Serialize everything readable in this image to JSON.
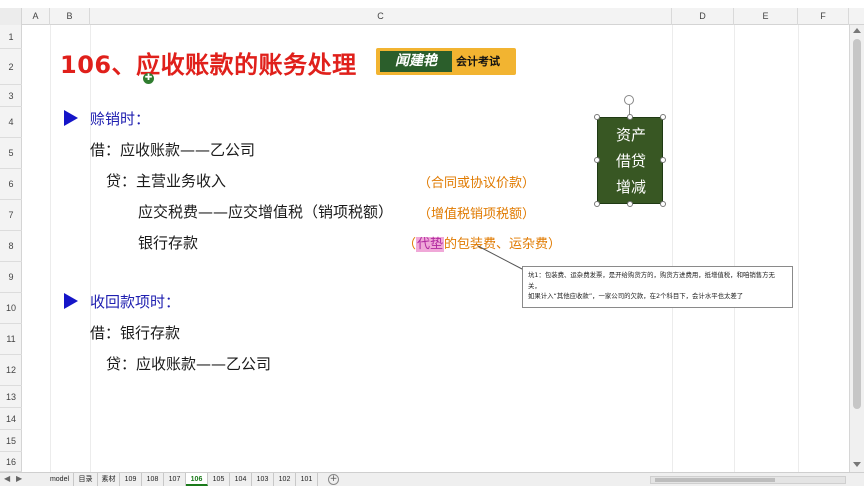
{
  "columns": [
    "A",
    "B",
    "C",
    "D",
    "E",
    "F"
  ],
  "rows": [
    "1",
    "2",
    "3",
    "4",
    "5",
    "6",
    "7",
    "8",
    "9",
    "10",
    "11",
    "12",
    "13",
    "14",
    "15",
    "16"
  ],
  "title": "106、应收账款的账务处理",
  "logo": {
    "main": "闻建艳",
    "sub": "会计考试"
  },
  "sections": {
    "sale": {
      "heading": "赊销时：",
      "lines": [
        "借：应收账款——乙公司",
        "贷：主营业务收入",
        "应交税费——应交增值税（销项税额）",
        "银行存款"
      ]
    },
    "collect": {
      "heading": "收回款项时：",
      "lines": [
        "借：银行存款",
        "贷：应收账款——乙公司"
      ]
    }
  },
  "notes": {
    "n1": "（合同或协议价款）",
    "n2": "（增值税销项税额）",
    "n3_open": "（",
    "n3_hl": "代垫",
    "n3_rest": "的包装费、运杂费）"
  },
  "shape": {
    "lines": [
      "资产",
      "借贷",
      "增减"
    ]
  },
  "comment": {
    "line1": "坑1：包装费、运杂费发票，是开给购货方的，购货方进费用，抵增值税，和咱销售方无关，",
    "line2": "如果计入“其他应收款”，一家公司的欠款，在2个科目下，会计水平也太差了"
  },
  "sheet_tabs": [
    "model",
    "目录",
    "素材",
    "109",
    "108",
    "107",
    "106",
    "105",
    "104",
    "103",
    "102",
    "101"
  ],
  "active_tab": "106",
  "colors": {
    "title": "#e0201b",
    "accent_blue": "#1515c8",
    "note_orange": "#e07a00",
    "shape_green": "#385723"
  }
}
